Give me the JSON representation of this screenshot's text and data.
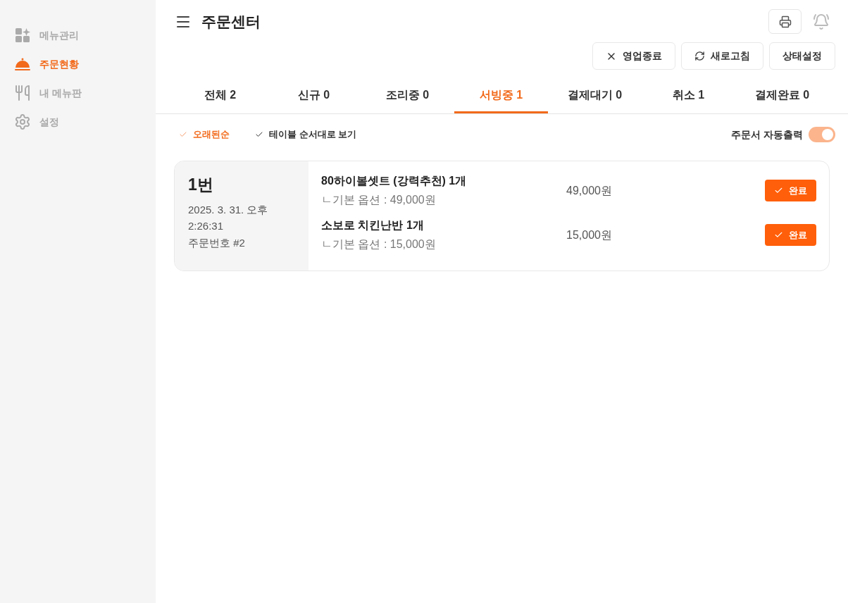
{
  "sidebar": {
    "items": [
      {
        "label": "메뉴관리",
        "selected": false
      },
      {
        "label": "주문현황",
        "selected": true
      },
      {
        "label": "내 메뉴판",
        "selected": false
      },
      {
        "label": "설정",
        "selected": false
      }
    ]
  },
  "header": {
    "title": "주문센터"
  },
  "actions": [
    {
      "label": "영업종료",
      "kind": "close"
    },
    {
      "label": "새로고침",
      "kind": "refresh"
    },
    {
      "label": "상태설정",
      "kind": "plain"
    }
  ],
  "tabs": [
    {
      "label": "전체 2",
      "selected": false
    },
    {
      "label": "신규 0",
      "selected": false
    },
    {
      "label": "조리중 0",
      "selected": false
    },
    {
      "label": "서빙중 1",
      "selected": true
    },
    {
      "label": "결제대기 0",
      "selected": false
    },
    {
      "label": "취소 1",
      "selected": false
    },
    {
      "label": "결제완료 0",
      "selected": false
    }
  ],
  "sort_options": [
    {
      "label": "오래된순",
      "selected": true
    },
    {
      "label": "테이블 순서대로 보기",
      "selected": false
    }
  ],
  "auto_print": {
    "label": "주문서 자동출력",
    "on": true
  },
  "orders": [
    {
      "table": "1번",
      "date": "2025. 3. 31. 오후",
      "time": "2:26:31",
      "order_no": "주문번호 #2",
      "items": [
        {
          "name": "80하이볼셋트 (강력추천) 1개",
          "option": "ㄴ기본 옵션 : 49,000원",
          "price": "49,000원",
          "button": "완료"
        },
        {
          "name": "소보로 치킨난반 1개",
          "option": "ㄴ기본 옵션 : 15,000원",
          "price": "15,000원",
          "button": "완료"
        }
      ]
    }
  ]
}
